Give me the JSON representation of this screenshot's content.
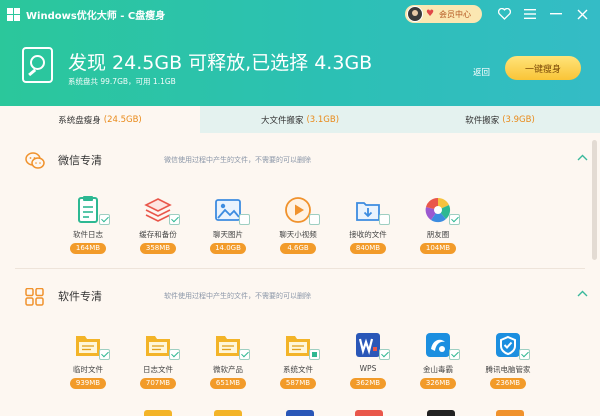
{
  "app": {
    "title": "Windows优化大师 - C盘瘦身",
    "member_label": "会员中心"
  },
  "summary": {
    "headline": "发现 24.5GB 可释放,已选择 4.3GB",
    "subline": "系统盘共 99.7GB，可用 1.1GB",
    "back_label": "返回",
    "slim_button": "一键瘦身"
  },
  "tabs": [
    {
      "label": "系统盘瘦身",
      "size": "(24.5GB)",
      "active": true
    },
    {
      "label": "大文件搬家",
      "size": "(3.1GB)",
      "active": false
    },
    {
      "label": "软件搬家",
      "size": "(3.9GB)",
      "active": false
    }
  ],
  "sections": [
    {
      "title": "微信专清",
      "desc": "微信使用过程中产生的文件，不需要的可以删除",
      "items": [
        {
          "name": "软件日志",
          "size": "164MB",
          "icon": "log-icon",
          "checked": "on"
        },
        {
          "name": "缓存和备份",
          "size": "358MB",
          "icon": "layers-icon",
          "checked": "on"
        },
        {
          "name": "聊天图片",
          "size": "14.0GB",
          "icon": "image-icon",
          "checked": "off"
        },
        {
          "name": "聊天小视频",
          "size": "4.6GB",
          "icon": "video-icon",
          "checked": "off"
        },
        {
          "name": "接收的文件",
          "size": "840MB",
          "icon": "download-icon",
          "checked": "off"
        },
        {
          "name": "朋友圈",
          "size": "104MB",
          "icon": "aperture-icon",
          "checked": "on"
        }
      ]
    },
    {
      "title": "软件专清",
      "desc": "软件使用过程中产生的文件，不需要的可以删除",
      "items": [
        {
          "name": "临时文件",
          "size": "939MB",
          "icon": "folder-icon",
          "checked": "on"
        },
        {
          "name": "日志文件",
          "size": "707MB",
          "icon": "folder-icon",
          "checked": "on"
        },
        {
          "name": "微软产品",
          "size": "651MB",
          "icon": "folder-icon",
          "checked": "on"
        },
        {
          "name": "系统文件",
          "size": "587MB",
          "icon": "folder-icon",
          "checked": "part"
        },
        {
          "name": "WPS",
          "size": "362MB",
          "icon": "wps-icon",
          "checked": "on"
        },
        {
          "name": "金山毒霸",
          "size": "326MB",
          "icon": "duba-icon",
          "checked": "on"
        },
        {
          "name": "腾讯电脑管家",
          "size": "236MB",
          "icon": "tencent-pcmgr-icon",
          "checked": "on"
        }
      ]
    }
  ],
  "colors": {
    "accent": "#2cc0a8",
    "badge": "#f29b2a",
    "size_highlight": "#e98a1a"
  }
}
